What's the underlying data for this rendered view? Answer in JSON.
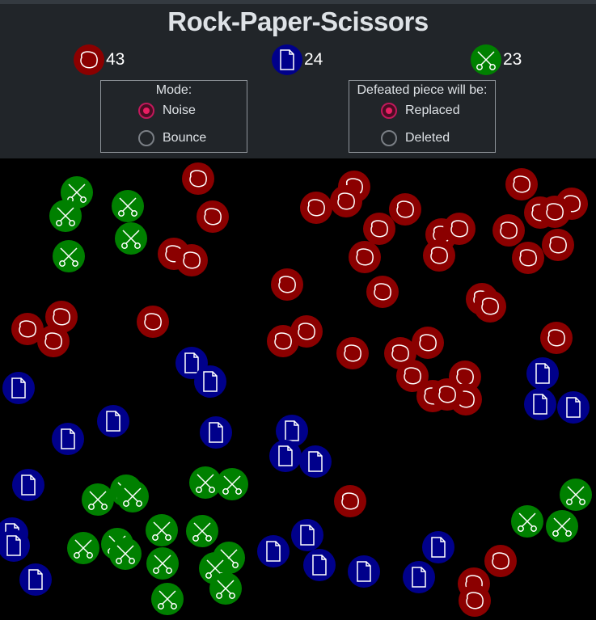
{
  "title": "Rock-Paper-Scissors",
  "counts": {
    "rock": {
      "icon": "rock-icon",
      "value": "43",
      "color": "#8b0000"
    },
    "paper": {
      "icon": "paper-icon",
      "value": "24",
      "color": "#00008b"
    },
    "scissors": {
      "icon": "scissors-icon",
      "value": "23",
      "color": "#008000"
    }
  },
  "mode": {
    "legend": "Mode:",
    "options": [
      "Noise",
      "Bounce"
    ],
    "selected": "Noise"
  },
  "defeated": {
    "legend": "Defeated piece will be:",
    "options": [
      "Replaced",
      "Deleted"
    ],
    "selected": "Replaced"
  },
  "colors": {
    "accent": "#e91e63",
    "rock": "#8b0000",
    "paper": "#00008b",
    "scissors": "#008000"
  },
  "pieces": {
    "rock": [
      [
        245,
        221
      ],
      [
        263,
        268
      ],
      [
        438,
        231
      ],
      [
        428,
        249
      ],
      [
        391,
        257
      ],
      [
        501,
        259
      ],
      [
        645,
        228
      ],
      [
        707,
        252
      ],
      [
        668,
        263
      ],
      [
        686,
        262
      ],
      [
        629,
        285
      ],
      [
        469,
        283
      ],
      [
        546,
        290
      ],
      [
        568,
        283
      ],
      [
        451,
        318
      ],
      [
        543,
        316
      ],
      [
        653,
        319
      ],
      [
        690,
        303
      ],
      [
        215,
        314
      ],
      [
        237,
        322
      ],
      [
        355,
        352
      ],
      [
        473,
        361
      ],
      [
        596,
        370
      ],
      [
        606,
        379
      ],
      [
        189,
        398
      ],
      [
        76,
        392
      ],
      [
        34,
        407
      ],
      [
        66,
        422
      ],
      [
        350,
        422
      ],
      [
        379,
        410
      ],
      [
        436,
        437
      ],
      [
        495,
        437
      ],
      [
        529,
        424
      ],
      [
        688,
        418
      ],
      [
        510,
        465
      ],
      [
        575,
        466
      ],
      [
        535,
        490
      ],
      [
        576,
        494
      ],
      [
        553,
        488
      ],
      [
        433,
        620
      ],
      [
        619,
        694
      ],
      [
        586,
        722
      ],
      [
        587,
        743
      ]
    ],
    "paper": [
      [
        237,
        449
      ],
      [
        260,
        472
      ],
      [
        23,
        480
      ],
      [
        140,
        521
      ],
      [
        84,
        543
      ],
      [
        267,
        535
      ],
      [
        361,
        533
      ],
      [
        353,
        564
      ],
      [
        390,
        571
      ],
      [
        671,
        462
      ],
      [
        668,
        500
      ],
      [
        709,
        504
      ],
      [
        35,
        600
      ],
      [
        15,
        660
      ],
      [
        17,
        675
      ],
      [
        44,
        717
      ],
      [
        338,
        682
      ],
      [
        380,
        662
      ],
      [
        395,
        699
      ],
      [
        450,
        707
      ],
      [
        542,
        677
      ],
      [
        518,
        714
      ]
    ],
    "scissors": [
      [
        95,
        238
      ],
      [
        81,
        267
      ],
      [
        158,
        255
      ],
      [
        162,
        295
      ],
      [
        85,
        317
      ],
      [
        121,
        618
      ],
      [
        156,
        607
      ],
      [
        164,
        614
      ],
      [
        254,
        597
      ],
      [
        287,
        599
      ],
      [
        712,
        612
      ],
      [
        652,
        645
      ],
      [
        695,
        651
      ],
      [
        103,
        678
      ],
      [
        145,
        673
      ],
      [
        155,
        685
      ],
      [
        200,
        656
      ],
      [
        250,
        657
      ],
      [
        201,
        697
      ],
      [
        283,
        690
      ],
      [
        266,
        703
      ],
      [
        279,
        728
      ],
      [
        207,
        741
      ]
    ]
  }
}
